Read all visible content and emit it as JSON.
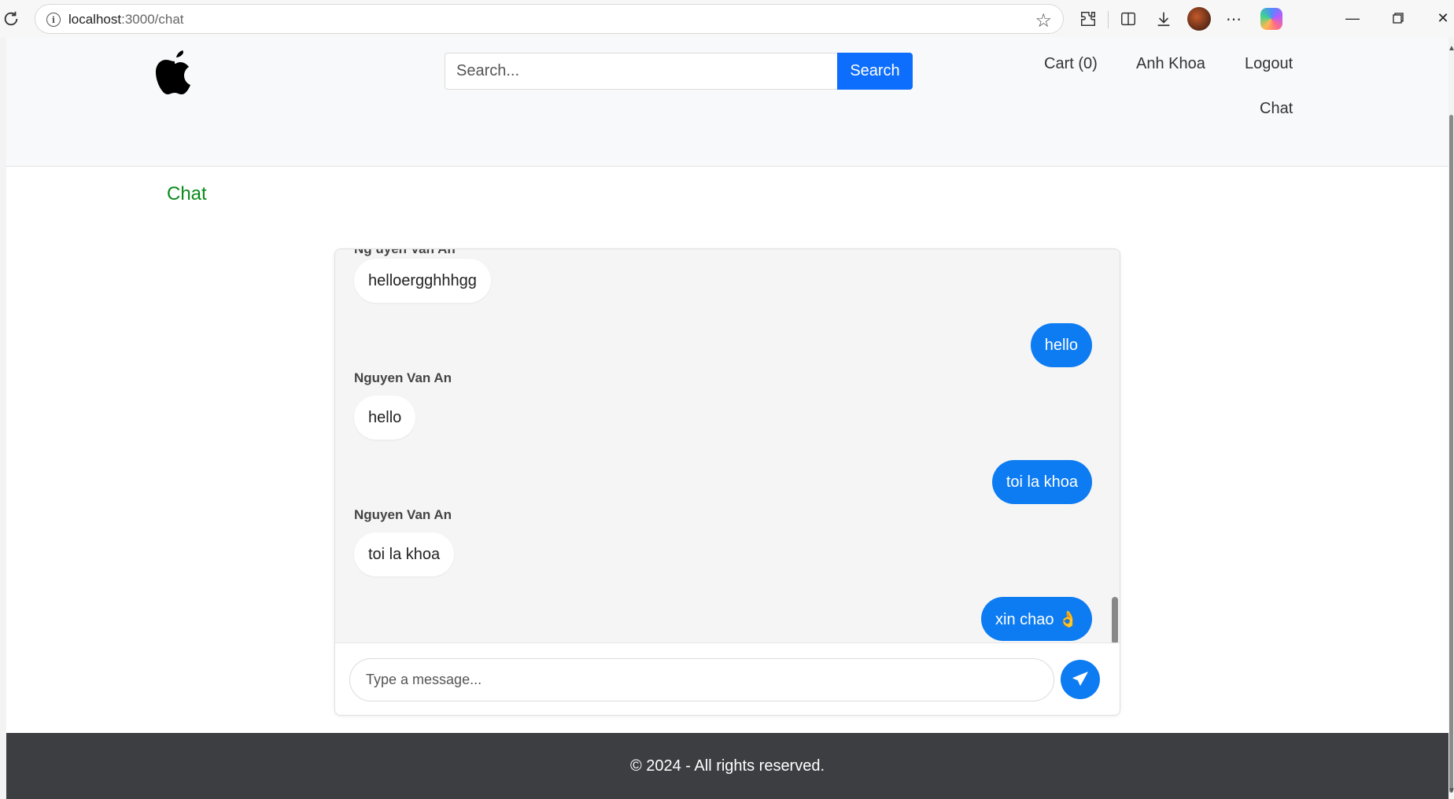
{
  "browser": {
    "url_host": "localhost",
    "url_path": ":3000/chat"
  },
  "header": {
    "search_placeholder": "Search...",
    "search_button": "Search",
    "nav": {
      "cart": "Cart (0)",
      "user": "Anh Khoa",
      "logout": "Logout",
      "chat": "Chat"
    }
  },
  "main": {
    "title": "Chat"
  },
  "chat": {
    "messages": [
      {
        "direction": "in",
        "text": "helloergghhhgg"
      },
      {
        "direction": "out",
        "text": "hello"
      },
      {
        "direction": "in",
        "sender": "Nguyen Van An",
        "text": "hello"
      },
      {
        "direction": "out",
        "text": "toi la khoa"
      },
      {
        "direction": "in",
        "sender": "Nguyen Van An",
        "text": "toi la khoa"
      },
      {
        "direction": "out",
        "text": "xin chao 👌"
      }
    ],
    "input_placeholder": "Type a message..."
  },
  "footer": {
    "text": "© 2024 - All rights reserved."
  },
  "colors": {
    "accent": "#0d6efd",
    "title_green": "#0a8a1a",
    "footer_bg": "#3d3e42"
  }
}
